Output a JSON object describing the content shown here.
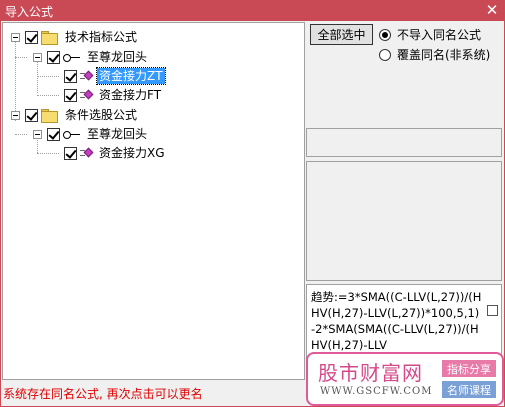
{
  "window": {
    "title": "导入公式",
    "close_icon": "close-icon"
  },
  "tree": {
    "groups": [
      {
        "label": "技术指标公式",
        "checked": true,
        "icon": "folder-icon",
        "children": [
          {
            "label": "至尊龙回头",
            "checked": true,
            "icon": "key-icon",
            "children": [
              {
                "label": "资金接力ZT",
                "checked": true,
                "selected": true,
                "icon": "formula-icon"
              },
              {
                "label": "资金接力FT",
                "checked": true,
                "selected": false,
                "icon": "formula-icon"
              }
            ]
          }
        ]
      },
      {
        "label": "条件选股公式",
        "checked": true,
        "icon": "folder-icon",
        "children": [
          {
            "label": "至尊龙回头",
            "checked": true,
            "icon": "key-icon",
            "children": [
              {
                "label": "资金接力XG",
                "checked": true,
                "selected": false,
                "icon": "formula-icon"
              }
            ]
          }
        ]
      }
    ]
  },
  "actions": {
    "select_all_label": "全部选中"
  },
  "options": {
    "skip_same_name": {
      "label": "不导入同名公式",
      "selected": true
    },
    "overwrite_same_name": {
      "label": "覆盖同名(非系统)",
      "selected": false
    }
  },
  "formula_preview": {
    "text": "趋势:=3*SMA((C-LLV(L,27))/(HHV(H,27)-LLV(L,27))*100,5,1)-2*SMA(SMA((C-LLV(L,27))/(HHV(H,27)-LLV",
    "checked": false
  },
  "status": {
    "message": "系统存在同名公式, 再次点击可以更名",
    "color": "#e00000"
  },
  "watermark": {
    "logo": "股市财富网",
    "url": "WWW.GSCFW.COM",
    "tag1": "指标分享",
    "tag2": "名师课程"
  },
  "colors": {
    "titlebar": "#c94a55",
    "selection": "#3399ff"
  }
}
